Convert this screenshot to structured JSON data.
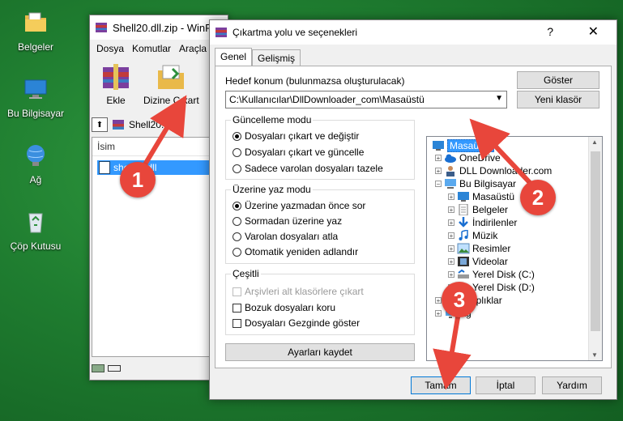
{
  "desktop": {
    "icons": [
      {
        "label": "Belgeler",
        "icon": "folder-documents-icon"
      },
      {
        "label": "Bu Bilgisayar",
        "icon": "computer-icon"
      },
      {
        "label": "Ağ",
        "icon": "network-icon"
      },
      {
        "label": "Çöp Kutusu",
        "icon": "recycle-bin-icon"
      }
    ]
  },
  "winrar": {
    "title": "Shell20.dll.zip - WinR",
    "menu": [
      "Dosya",
      "Komutlar",
      "Araçla"
    ],
    "tools": [
      {
        "label": "Ekle"
      },
      {
        "label": "Dizine Çıkart"
      }
    ],
    "address": "Shell20.dll.",
    "column": "İsim",
    "file": "shell20.dll"
  },
  "dialog": {
    "title": "Çıkartma yolu ve seçenekleri",
    "help": "?",
    "close": "✕",
    "tabs": [
      "Genel",
      "Gelişmiş"
    ],
    "target_label": "Hedef konum (bulunmazsa oluşturulacak)",
    "target_value": "C:\\Kullanıcılar\\DllDownloader_com\\Masaüstü",
    "buttons": {
      "show": "Göster",
      "new_folder": "Yeni klasör",
      "save": "Ayarları kaydet",
      "ok": "Tamam",
      "cancel": "İptal",
      "help": "Yardım"
    },
    "update_mode": {
      "title": "Güncelleme modu",
      "options": [
        "Dosyaları çıkart ve değiştir",
        "Dosyaları çıkart ve güncelle",
        "Sadece varolan dosyaları tazele"
      ],
      "selected": 0
    },
    "overwrite_mode": {
      "title": "Üzerine yaz modu",
      "options": [
        "Üzerine yazmadan önce sor",
        "Sormadan üzerine yaz",
        "Varolan dosyaları atla",
        "Otomatik yeniden adlandır"
      ],
      "selected": 0
    },
    "misc": {
      "title": "Çeşitli",
      "options": [
        {
          "label": "Arşivleri alt klasörlere çıkart",
          "checked": false,
          "disabled": true
        },
        {
          "label": "Bozuk dosyaları koru",
          "checked": false,
          "disabled": false
        },
        {
          "label": "Dosyaları Gezginde göster",
          "checked": false,
          "disabled": false
        }
      ]
    },
    "tree": [
      {
        "label": "Masaüstü",
        "level": 0,
        "selected": true,
        "icon": "desktop-icon"
      },
      {
        "label": "OneDrive",
        "level": 1,
        "icon": "cloud-icon"
      },
      {
        "label": "DLL Downloader.com",
        "level": 1,
        "icon": "user-icon"
      },
      {
        "label": "Bu Bilgisayar",
        "level": 1,
        "icon": "computer-icon"
      },
      {
        "label": "Masaüstü",
        "level": 2,
        "icon": "desktop-icon"
      },
      {
        "label": "Belgeler",
        "level": 2,
        "icon": "document-icon"
      },
      {
        "label": "İndirilenler",
        "level": 2,
        "icon": "download-icon"
      },
      {
        "label": "Müzik",
        "level": 2,
        "icon": "music-icon"
      },
      {
        "label": "Resimler",
        "level": 2,
        "icon": "pictures-icon"
      },
      {
        "label": "Videolar",
        "level": 2,
        "icon": "video-icon"
      },
      {
        "label": "Yerel Disk (C:)",
        "level": 2,
        "icon": "drive-icon"
      },
      {
        "label": "Yerel Disk (D:)",
        "level": 2,
        "icon": "drive-icon"
      },
      {
        "label": "Kitaplıklar",
        "level": 1,
        "icon": "library-icon"
      },
      {
        "label": "Ağ",
        "level": 1,
        "icon": "network-icon"
      }
    ]
  },
  "markers": [
    "1",
    "2",
    "3"
  ],
  "colors": {
    "selection": "#3399ff",
    "marker": "#e8463b",
    "accent": "#0078d7"
  }
}
